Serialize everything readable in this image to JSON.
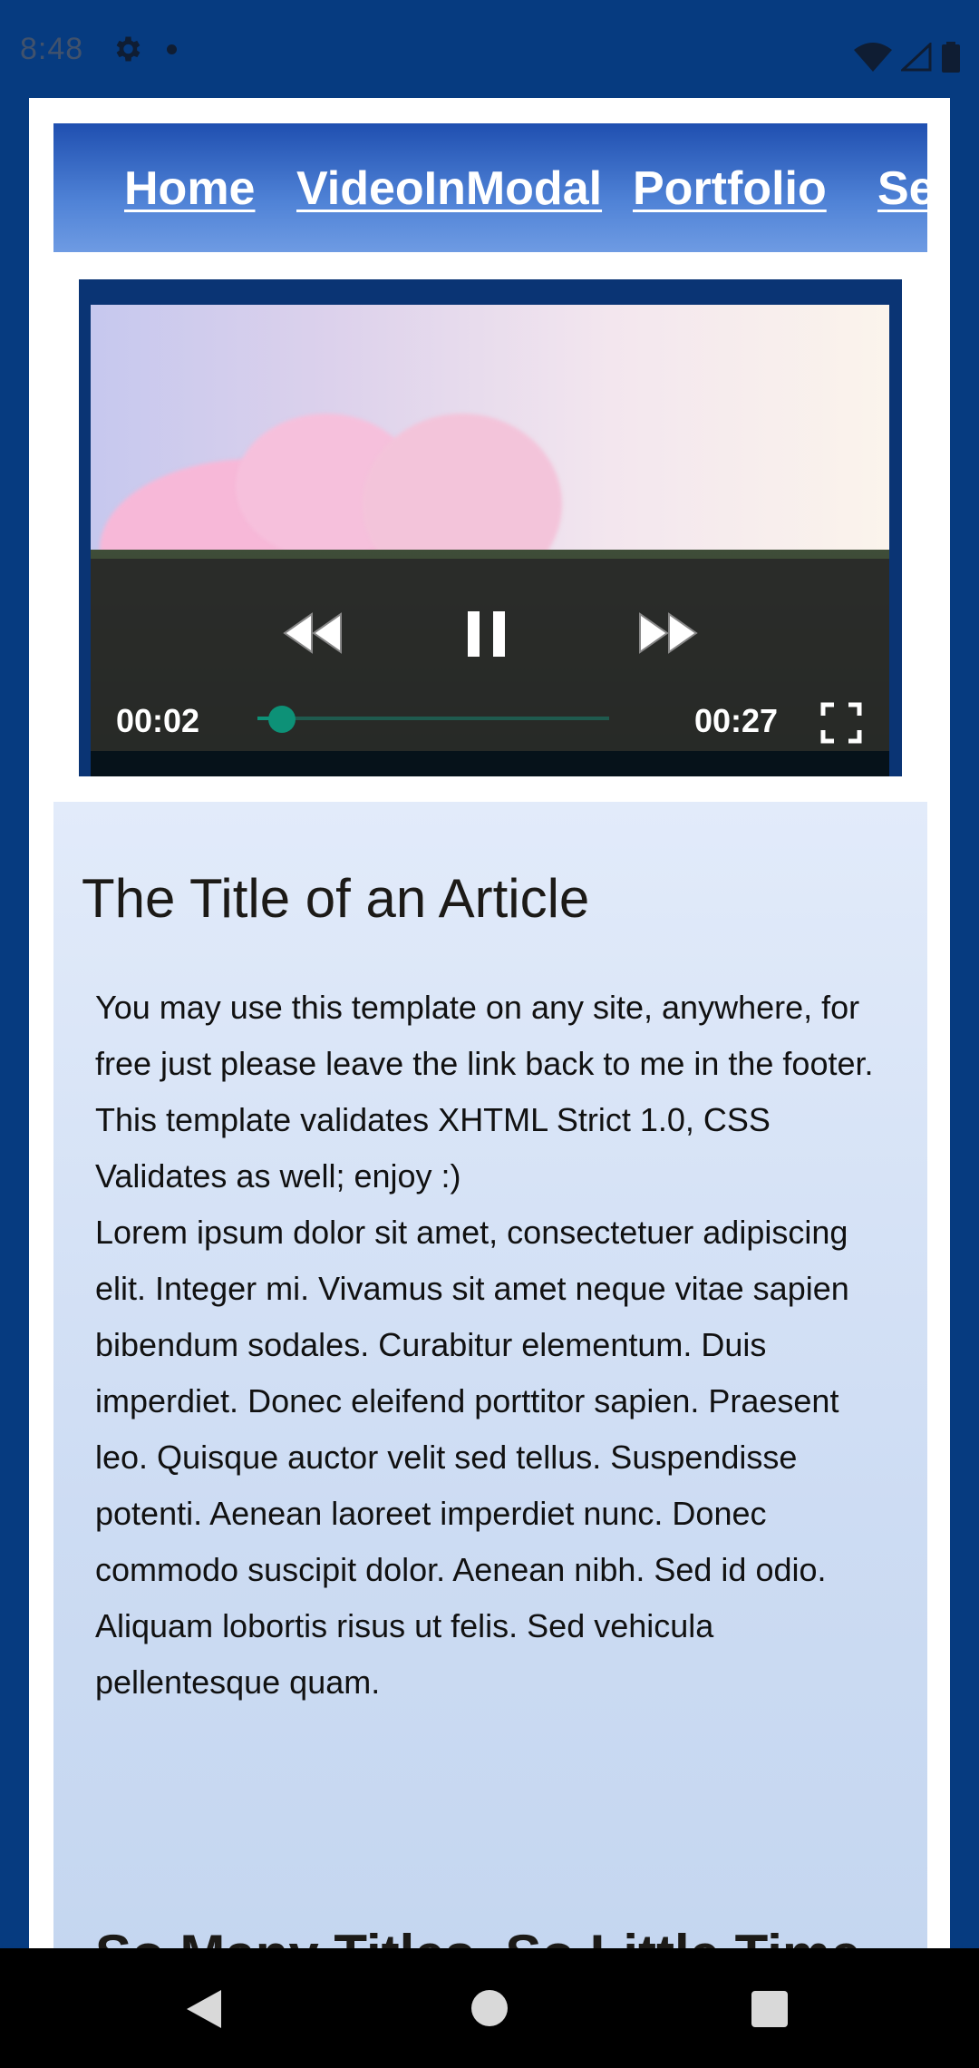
{
  "status_bar": {
    "time": "8:48"
  },
  "nav": {
    "links": [
      "Home",
      "VideoInModal",
      "Portfolio",
      "Se"
    ]
  },
  "video": {
    "current_time": "00:02",
    "duration": "00:27",
    "progress": 0.07
  },
  "article": {
    "title": "The Title of an Article",
    "paragraph1": "You may use this template on any site, anywhere, for free just please leave the link back to me in the footer. This template validates XHTML Strict 1.0, CSS Validates as well; enjoy :)",
    "paragraph2": "Lorem ipsum dolor sit amet, consectetuer adipiscing elit. Integer mi. Vivamus sit amet neque vitae sapien bibendum sodales. Curabitur elementum. Duis imperdiet. Donec eleifend porttitor sapien. Praesent leo. Quisque auctor velit sed tellus. Suspendisse potenti. Aenean laoreet imperdiet nunc. Donec commodo suscipit dolor. Aenean nibh. Sed id odio. Aliquam lobortis risus ut felis. Sed vehicula pellentesque quam.",
    "subtitle": "So Many Titles, So Little Time"
  },
  "colors": {
    "page_bg": "#063b80",
    "accent": "#0d9177"
  }
}
